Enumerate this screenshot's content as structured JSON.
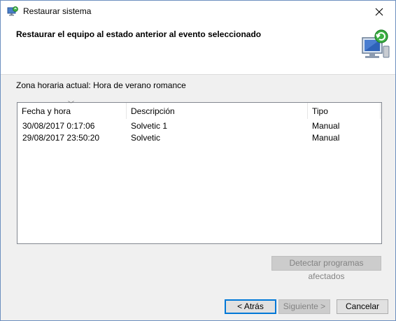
{
  "window": {
    "title": "Restaurar sistema",
    "close_symbol": "✕"
  },
  "header": {
    "title": "Restaurar el equipo al estado anterior al evento seleccionado"
  },
  "timezone": "Zona horaria actual: Hora de verano romance",
  "table": {
    "columns": [
      "Fecha y hora",
      "Descripción",
      "Tipo"
    ],
    "rows": [
      [
        "30/08/2017 0:17:06",
        "Solvetic 1",
        "Manual"
      ],
      [
        "29/08/2017 23:50:20",
        "Solvetic",
        "Manual"
      ]
    ]
  },
  "buttons": {
    "detect": "Detectar programas afectados",
    "back": "< Atrás",
    "next": "Siguiente >",
    "cancel": "Cancelar"
  },
  "icons": {
    "app": "system-restore-icon",
    "header": "system-restore-monitor-icon",
    "sort": "sort-indicator-icon",
    "close": "close-icon"
  },
  "colors": {
    "accent": "#0078d7",
    "disabled_text": "#838383"
  }
}
